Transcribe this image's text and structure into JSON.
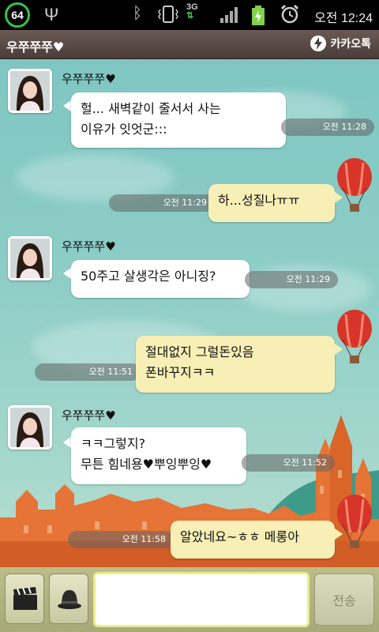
{
  "status_bar": {
    "battery_percent": "64",
    "network_type": "3G",
    "clock": "오전 12:24",
    "icons": [
      "usb-icon",
      "bluetooth-icon",
      "vibrate-icon",
      "network-3g-icon",
      "signal-icon",
      "battery-charging-icon",
      "alarm-icon"
    ]
  },
  "header": {
    "title": "우쭈쭈쭈♥",
    "brand": "카카오톡"
  },
  "messages": [
    {
      "sender": "우쭈쭈쭈♥",
      "text": "헐... 새벽같이 줄서서 사는\n이유가 잇엇군:::",
      "time": "오전 11:28",
      "direction": "incoming"
    },
    {
      "text": "하...성질나ㅠㅠ",
      "time": "오전 11:29",
      "direction": "outgoing"
    },
    {
      "sender": "우쭈쭈쭈♥",
      "text": "50주고 살생각은 아니징?",
      "time": "오전 11:29",
      "direction": "incoming"
    },
    {
      "text": "절대없지 그럴돈있음\n폰바꾸지ㅋㅋ",
      "time": "오전 11:51",
      "direction": "outgoing"
    },
    {
      "sender": "우쭈쭈쭈♥",
      "text": "ㅋㅋ그렇지?\n무튼 힘네용♥뿌잉뿌잉♥",
      "time": "오전 11:52",
      "direction": "incoming"
    },
    {
      "text": "알았네요~ㅎㅎ 메롱아",
      "time": "오전 11:58",
      "direction": "outgoing"
    }
  ],
  "input_bar": {
    "send_label": "전송",
    "input_value": ""
  },
  "colors": {
    "outgoing_bubble": "#f7efb6",
    "incoming_bubble": "#ffffff",
    "sky": "#8ccdc6",
    "input_highlight": "#e8ee8a"
  }
}
